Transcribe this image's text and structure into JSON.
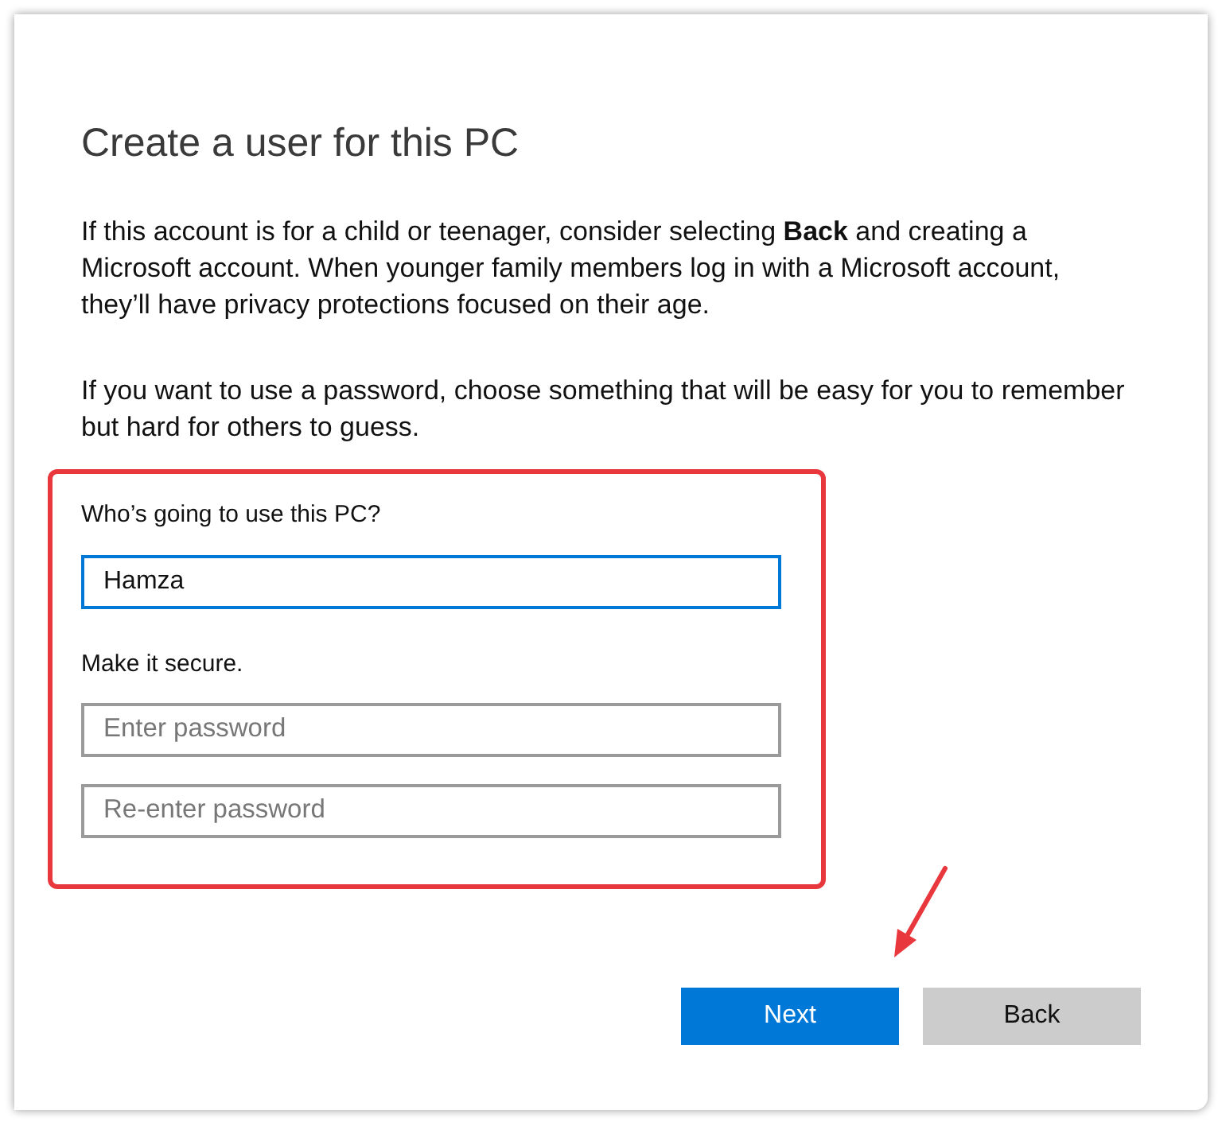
{
  "title": "Create a user for this PC",
  "paragraphs": [
    [
      "If this account is for a child or teenager, consider selecting **Back** and creating a",
      "Microsoft account. When younger family members log in with a Microsoft account,",
      "they’ll have privacy protections focused on their age."
    ],
    [
      "If you want to use a password, choose something that will be easy for you to remember",
      "but hard for others to guess."
    ]
  ],
  "form": {
    "highlighted": true,
    "sections": [
      {
        "label": "Who’s going to use this PC?",
        "fields": [
          {
            "value": "Hamza",
            "focused": true
          }
        ]
      },
      {
        "label": "Make it secure.",
        "fields": [
          {
            "placeholder": "Enter password",
            "focused": false
          },
          {
            "placeholder": "Re-enter password",
            "focused": false
          }
        ]
      }
    ]
  },
  "buttons": [
    {
      "label": "Next",
      "kind": "primary",
      "arrow": true
    },
    {
      "label": "Back",
      "kind": "secondary",
      "arrow": false
    }
  ]
}
